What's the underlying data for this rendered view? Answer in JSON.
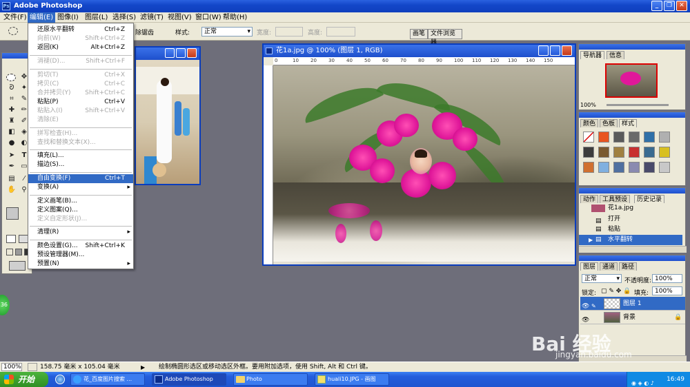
{
  "app": {
    "title": "Adobe Photoshop",
    "window_buttons": {
      "minimize": "_",
      "restore": "❐",
      "close": "✕"
    }
  },
  "menubar": [
    "文件(F)",
    "编辑(E)",
    "图像(I)",
    "图层(L)",
    "选择(S)",
    "滤镜(T)",
    "视图(V)",
    "窗口(W)",
    "帮助(H)"
  ],
  "options_bar": {
    "style_label": "样式:",
    "style_value": "正常",
    "width_label": "宽度:",
    "height_label": "高度:",
    "antialias_partial": "除锯齿",
    "well_tabs": [
      "画笔",
      "文件浏览器"
    ]
  },
  "edit_menu": {
    "items": [
      {
        "label": "还原水平翻转",
        "shortcut": "Ctrl+Z",
        "state": "normal"
      },
      {
        "label": "向前(W)",
        "shortcut": "Shift+Ctrl+Z",
        "state": "disabled"
      },
      {
        "label": "返回(K)",
        "shortcut": "Alt+Ctrl+Z",
        "state": "normal"
      },
      {
        "label": "消褪(D)...",
        "shortcut": "Shift+Ctrl+F",
        "state": "disabled"
      },
      {
        "label": "剪切(T)",
        "shortcut": "Ctrl+X",
        "state": "disabled"
      },
      {
        "label": "拷贝(C)",
        "shortcut": "Ctrl+C",
        "state": "disabled"
      },
      {
        "label": "合并拷贝(Y)",
        "shortcut": "Shift+Ctrl+C",
        "state": "disabled"
      },
      {
        "label": "粘贴(P)",
        "shortcut": "Ctrl+V",
        "state": "normal"
      },
      {
        "label": "粘贴入(I)",
        "shortcut": "Shift+Ctrl+V",
        "state": "disabled"
      },
      {
        "label": "清除(E)",
        "shortcut": "",
        "state": "disabled"
      },
      {
        "label": "拼写检查(H)...",
        "shortcut": "",
        "state": "disabled"
      },
      {
        "label": "查找和替换文本(X)...",
        "shortcut": "",
        "state": "disabled"
      },
      {
        "label": "填充(L)...",
        "shortcut": "",
        "state": "normal"
      },
      {
        "label": "描边(S)...",
        "shortcut": "",
        "state": "normal"
      },
      {
        "label": "自由变换(F)",
        "shortcut": "Ctrl+T",
        "state": "highlighted"
      },
      {
        "label": "变换(A)",
        "shortcut": "",
        "state": "submenu"
      },
      {
        "label": "定义画笔(B)...",
        "shortcut": "",
        "state": "normal"
      },
      {
        "label": "定义图案(Q)...",
        "shortcut": "",
        "state": "normal"
      },
      {
        "label": "定义自定形状(J)...",
        "shortcut": "",
        "state": "disabled"
      },
      {
        "label": "清理(R)",
        "shortcut": "",
        "state": "submenu"
      },
      {
        "label": "颜色设置(G)...",
        "shortcut": "Shift+Ctrl+K",
        "state": "normal"
      },
      {
        "label": "预设管理器(M)...",
        "shortcut": "",
        "state": "normal"
      },
      {
        "label": "预置(N)",
        "shortcut": "",
        "state": "submenu"
      }
    ]
  },
  "document": {
    "title": "花1a.jpg @ 100% (图层 1, RGB)",
    "ruler_ticks": [
      "0",
      "10",
      "20",
      "30",
      "40",
      "50",
      "60",
      "70",
      "80",
      "90",
      "100",
      "110",
      "120",
      "130",
      "140",
      "150"
    ]
  },
  "navigator": {
    "tabs": [
      "导航器",
      "信息"
    ],
    "zoom": "100%"
  },
  "swatches_panel": {
    "tabs": [
      "颜色",
      "色板",
      "样式"
    ]
  },
  "history_panel": {
    "tabs": [
      "动作",
      "工具预设",
      "历史记录"
    ],
    "snapshot": "花1a.jpg",
    "items": [
      {
        "label": "打开",
        "selected": false
      },
      {
        "label": "粘贴",
        "selected": false
      },
      {
        "label": "水平翻转",
        "selected": true
      }
    ]
  },
  "layers_panel": {
    "tabs": [
      "图层",
      "通道",
      "路径"
    ],
    "blend_mode": "正常",
    "opacity_label": "不透明度:",
    "opacity_value": "100%",
    "lock_label": "锁定:",
    "fill_label": "填充:",
    "fill_value": "100%",
    "layers": [
      {
        "name": "图层 1",
        "selected": true
      },
      {
        "name": "背景",
        "selected": false
      }
    ]
  },
  "status_bar": {
    "zoom": "100%",
    "doc_size": "158.75 毫米 x 105.04 毫米",
    "hint": "绘制椭圆形选区或移动选区外框。要用附加选项，使用 Shift, Alt 和 Ctrl 键。"
  },
  "taskbar": {
    "start_label": "开始",
    "tasks": [
      {
        "label": "花_百度图片搜索 ...",
        "active": false
      },
      {
        "label": "Adobe Photoshop",
        "active": true
      },
      {
        "label": "Photo",
        "active": false
      },
      {
        "label": "huali10.JPG - 画图",
        "active": false
      }
    ],
    "clock": "16:49"
  },
  "left_badge": "36",
  "watermark": {
    "main": "Bai 经验",
    "sub": "jingyan.baidu.com"
  }
}
